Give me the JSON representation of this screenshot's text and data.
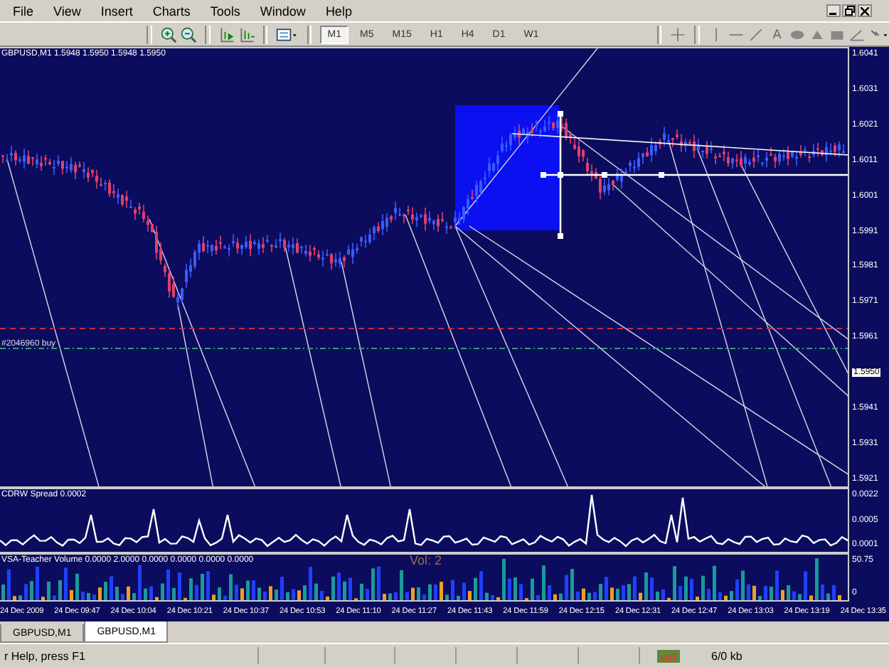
{
  "menu": [
    "File",
    "View",
    "Insert",
    "Charts",
    "Tools",
    "Window",
    "Help"
  ],
  "timeframes": [
    {
      "label": "M1",
      "selected": true
    },
    {
      "label": "M5",
      "selected": false
    },
    {
      "label": "M15",
      "selected": false
    },
    {
      "label": "H1",
      "selected": false
    },
    {
      "label": "H4",
      "selected": false
    },
    {
      "label": "D1",
      "selected": false
    },
    {
      "label": "W1",
      "selected": false
    }
  ],
  "text_tool": "A",
  "chart": {
    "title": "GBPUSD,M1  1.5948 1.5950 1.5948 1.5950",
    "order_label": "#2046960 buy",
    "price_axis": [
      {
        "label": "1.6041",
        "kind": "tick"
      },
      {
        "label": "1.6031",
        "kind": "tick"
      },
      {
        "label": "1.6021",
        "kind": "tick"
      },
      {
        "label": "1.6011",
        "kind": "tick"
      },
      {
        "label": "1.6001",
        "kind": "tick"
      },
      {
        "label": "1.5991",
        "kind": "tick"
      },
      {
        "label": "1.5981",
        "kind": "tick"
      },
      {
        "label": "1.5971",
        "kind": "tick"
      },
      {
        "label": "1.5961",
        "kind": "tick"
      },
      {
        "label": "1.5950",
        "kind": "current"
      },
      {
        "label": "1.5941",
        "kind": "tick"
      },
      {
        "label": "1.5931",
        "kind": "tick"
      },
      {
        "label": "1.5921",
        "kind": "tick"
      }
    ]
  },
  "spread_indicator": {
    "title": "CDRW Spread 0.0002",
    "axis": [
      "0.0022",
      "0.0005",
      "0.0001"
    ]
  },
  "volume_indicator": {
    "title": "VSA-Teacher Volume 0.0000 2.0000 0.0000 0.0000 0.0000 0.0000",
    "overlay": "Vol: 2",
    "axis": [
      "50.75",
      "0"
    ]
  },
  "time_axis": [
    "24 Dec 2009",
    "24 Dec 09:47",
    "24 Dec 10:04",
    "24 Dec 10:21",
    "24 Dec 10:37",
    "24 Dec 10:53",
    "24 Dec 11:10",
    "24 Dec 11:27",
    "24 Dec 11:43",
    "24 Dec 11:59",
    "24 Dec 12:15",
    "24 Dec 12:31",
    "24 Dec 12:47",
    "24 Dec 13:03",
    "24 Dec 13:19",
    "24 Dec 13:35"
  ],
  "tabs": [
    {
      "label": "GBPUSD,M1",
      "selected": false
    },
    {
      "label": "GBPUSD,M1",
      "selected": true
    }
  ],
  "status_bar": {
    "help": "r Help, press F1",
    "traffic": "6/0 kb"
  }
}
